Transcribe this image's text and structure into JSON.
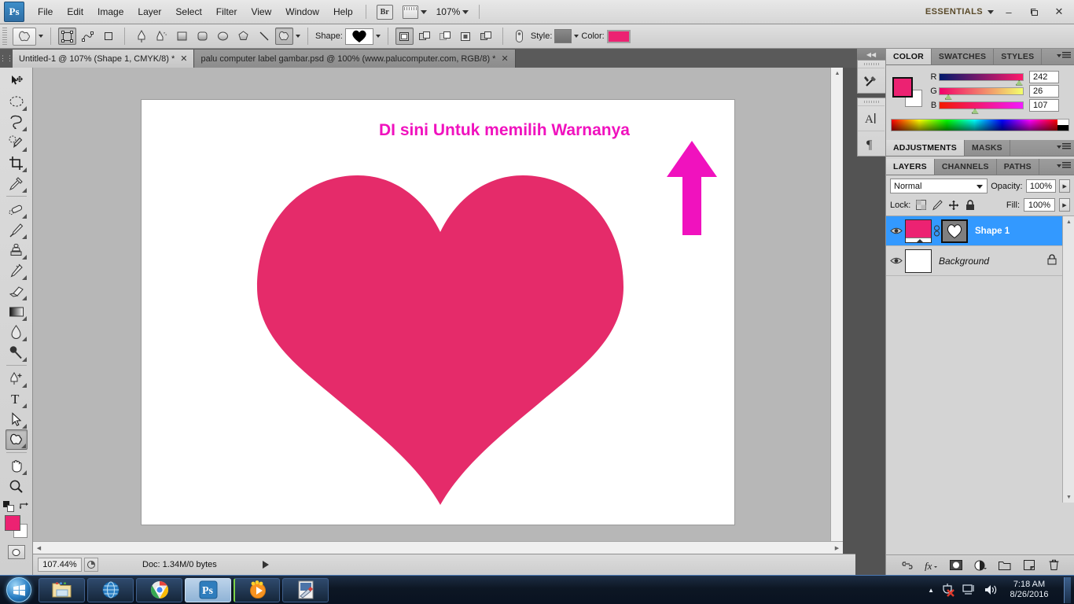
{
  "app": {
    "logo": "Ps",
    "menus": [
      "File",
      "Edit",
      "Image",
      "Layer",
      "Select",
      "Filter",
      "View",
      "Window",
      "Help"
    ],
    "bridge_label": "Br",
    "zoom_level": "107%",
    "workspace": "ESSENTIALS",
    "window_buttons": {
      "minimize": "–",
      "restore": "❐",
      "close": "✕"
    }
  },
  "options_bar": {
    "shape_label": "Shape:",
    "style_label": "Style:",
    "color_label": "Color:",
    "color_value": "#ec2272",
    "shape_glyph": "♥",
    "tool_icon": "custom-shape-tool"
  },
  "tabs": [
    {
      "title": "Untitled-1 @ 107% (Shape 1, CMYK/8) *",
      "active": true,
      "close": "✕"
    },
    {
      "title": "palu computer label gambar.psd @ 100% (www.palucomputer.com, RGB/8) *",
      "active": false,
      "close": "✕"
    }
  ],
  "toolbar": {
    "tools": [
      {
        "name": "move-tool",
        "glyph": "move"
      },
      {
        "name": "elliptical-marquee-tool",
        "glyph": "ellipse"
      },
      {
        "name": "lasso-tool",
        "glyph": "lasso"
      },
      {
        "name": "quick-selection-tool",
        "glyph": "wand"
      },
      {
        "name": "crop-tool",
        "glyph": "crop"
      },
      {
        "name": "eyedropper-tool",
        "glyph": "eyedropper"
      },
      {
        "name": "spot-healing-brush-tool",
        "glyph": "healing"
      },
      {
        "name": "brush-tool",
        "glyph": "brush"
      },
      {
        "name": "clone-stamp-tool",
        "glyph": "stamp"
      },
      {
        "name": "history-brush-tool",
        "glyph": "history"
      },
      {
        "name": "eraser-tool",
        "glyph": "eraser"
      },
      {
        "name": "gradient-tool",
        "glyph": "gradient"
      },
      {
        "name": "blur-tool",
        "glyph": "blur"
      },
      {
        "name": "dodge-tool",
        "glyph": "dodge"
      },
      {
        "name": "pen-tool",
        "glyph": "pen"
      },
      {
        "name": "horizontal-type-tool",
        "glyph": "T"
      },
      {
        "name": "path-selection-tool",
        "glyph": "arrow"
      },
      {
        "name": "custom-shape-tool",
        "glyph": "customshape",
        "selected": true
      },
      {
        "name": "hand-tool",
        "glyph": "hand"
      },
      {
        "name": "zoom-tool",
        "glyph": "magnifier"
      }
    ],
    "foreground_color": "#ec2272",
    "background_color": "#ffffff"
  },
  "canvas": {
    "annotation_text": "DI sini Untuk memilih Warnanya",
    "annotation_color": "#f012be",
    "arrow_color": "#f012be",
    "heart_color": "#e52b6a",
    "page_background": "#ffffff"
  },
  "status_bar": {
    "zoom": "107.44%",
    "doc_info": "Doc: 1.34M/0 bytes"
  },
  "mini_dock": [
    {
      "name": "tool-presets-icon"
    },
    {
      "name": "character-panel-icon"
    },
    {
      "name": "paragraph-panel-icon"
    }
  ],
  "color_panel": {
    "tabs": [
      {
        "label": "COLOR",
        "active": true
      },
      {
        "label": "SWATCHES",
        "active": false
      },
      {
        "label": "STYLES",
        "active": false
      }
    ],
    "foreground": "#ec2272",
    "background": "#ffffff",
    "channels": [
      {
        "label": "R",
        "value": "242",
        "percent": 95
      },
      {
        "label": "G",
        "value": "26",
        "percent": 10
      },
      {
        "label": "B",
        "value": "107",
        "percent": 42
      }
    ]
  },
  "adjustments_panel": {
    "tabs": [
      {
        "label": "ADJUSTMENTS",
        "active": true
      },
      {
        "label": "MASKS",
        "active": false
      }
    ]
  },
  "layers_panel": {
    "tabs": [
      {
        "label": "LAYERS",
        "active": true
      },
      {
        "label": "CHANNELS",
        "active": false
      },
      {
        "label": "PATHS",
        "active": false
      }
    ],
    "blend_mode": "Normal",
    "opacity_label": "Opacity:",
    "opacity_value": "100%",
    "lock_label": "Lock:",
    "fill_label": "Fill:",
    "fill_value": "100%",
    "lock_icons": [
      "lock-transparent-pixels-icon",
      "lock-image-pixels-icon",
      "lock-position-icon",
      "lock-all-icon"
    ],
    "layers": [
      {
        "name": "Shape 1",
        "selected": true,
        "visible": true,
        "has_mask": true,
        "thumb_color": "#ec2272",
        "locked": false
      },
      {
        "name": "Background",
        "selected": false,
        "visible": true,
        "has_mask": false,
        "thumb_color": "#ffffff",
        "locked": true
      }
    ],
    "footer_icons": [
      "link-layers-icon",
      "layer-style-icon",
      "add-layer-mask-icon",
      "new-adjustment-layer-icon",
      "new-group-icon",
      "new-layer-icon",
      "delete-layer-icon"
    ]
  },
  "taskbar": {
    "start": "windows-start-orb",
    "items": [
      {
        "name": "windows-explorer",
        "icon": "folder"
      },
      {
        "name": "internet-explorer",
        "icon": "globe"
      },
      {
        "name": "google-chrome",
        "icon": "chrome"
      },
      {
        "name": "adobe-photoshop",
        "icon": "ps",
        "active": true
      },
      {
        "name": "media-player",
        "icon": "media"
      },
      {
        "name": "paint-program",
        "icon": "paint"
      }
    ],
    "tray": {
      "show_hidden": "▲",
      "icons": [
        "antivirus-icon",
        "network-icon",
        "volume-icon"
      ],
      "time": "7:18 AM",
      "date": "8/26/2016"
    }
  }
}
